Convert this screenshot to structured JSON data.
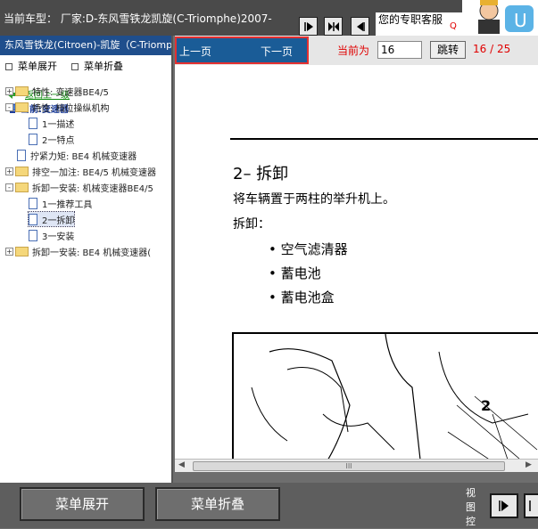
{
  "header": {
    "car_model": "当前车型： 厂家:D-东风雪铁龙凯旋(C-Triomphe)2007-",
    "service_label": "您的专职客服",
    "service_mark": "Q"
  },
  "left": {
    "title": "东风雪铁龙(Citroen)-凯旋（C-Triomphe）",
    "expand_label": "菜单展开",
    "collapse_label": "菜单折叠",
    "back_label": "返回上一级",
    "current_label": "当前:变速器",
    "tree": [
      {
        "label": "特性: 变速器BE4/5",
        "type": "folder",
        "pm": "+"
      },
      {
        "label": "特性: 档位操纵机构",
        "type": "folder",
        "pm": "-"
      },
      {
        "label": "1一描述",
        "type": "page"
      },
      {
        "label": "2一特点",
        "type": "page"
      },
      {
        "label": "拧紧力矩: BE4 机械变速器",
        "type": "page"
      },
      {
        "label": "排空一加注: BE4/5 机械变速器",
        "type": "folder",
        "pm": "+"
      },
      {
        "label": "拆卸一安装: 机械变速器BE4/5",
        "type": "folder",
        "pm": "-"
      },
      {
        "label": "1一推荐工具",
        "type": "page"
      },
      {
        "label": "2一拆卸",
        "type": "page",
        "selected": true
      },
      {
        "label": "3一安装",
        "type": "page"
      },
      {
        "label": "拆卸一安装: BE4 机械变速器(",
        "type": "folder",
        "pm": "+"
      }
    ]
  },
  "nav": {
    "prev_label": "上一页",
    "next_label": "下一页",
    "current_label": "当前为",
    "page_value": "16",
    "jump_label": "跳转",
    "page_count": "16 / 25"
  },
  "doc": {
    "title": "2– 拆卸",
    "line1": "将车辆置于两柱的举升机上。",
    "line2": "拆卸：",
    "bullets": [
      "空气滤清器",
      "蓄电池",
      "蓄电池盒"
    ],
    "figure_label": "2"
  },
  "scroll": {
    "thumb": "III"
  },
  "bottom": {
    "expand_label": "菜单展开",
    "collapse_label": "菜单折叠",
    "view_ctrl": "视图控"
  },
  "colors": {
    "accent": "#1a5c97",
    "highlight": "#e53030",
    "red_text": "#e00000"
  }
}
